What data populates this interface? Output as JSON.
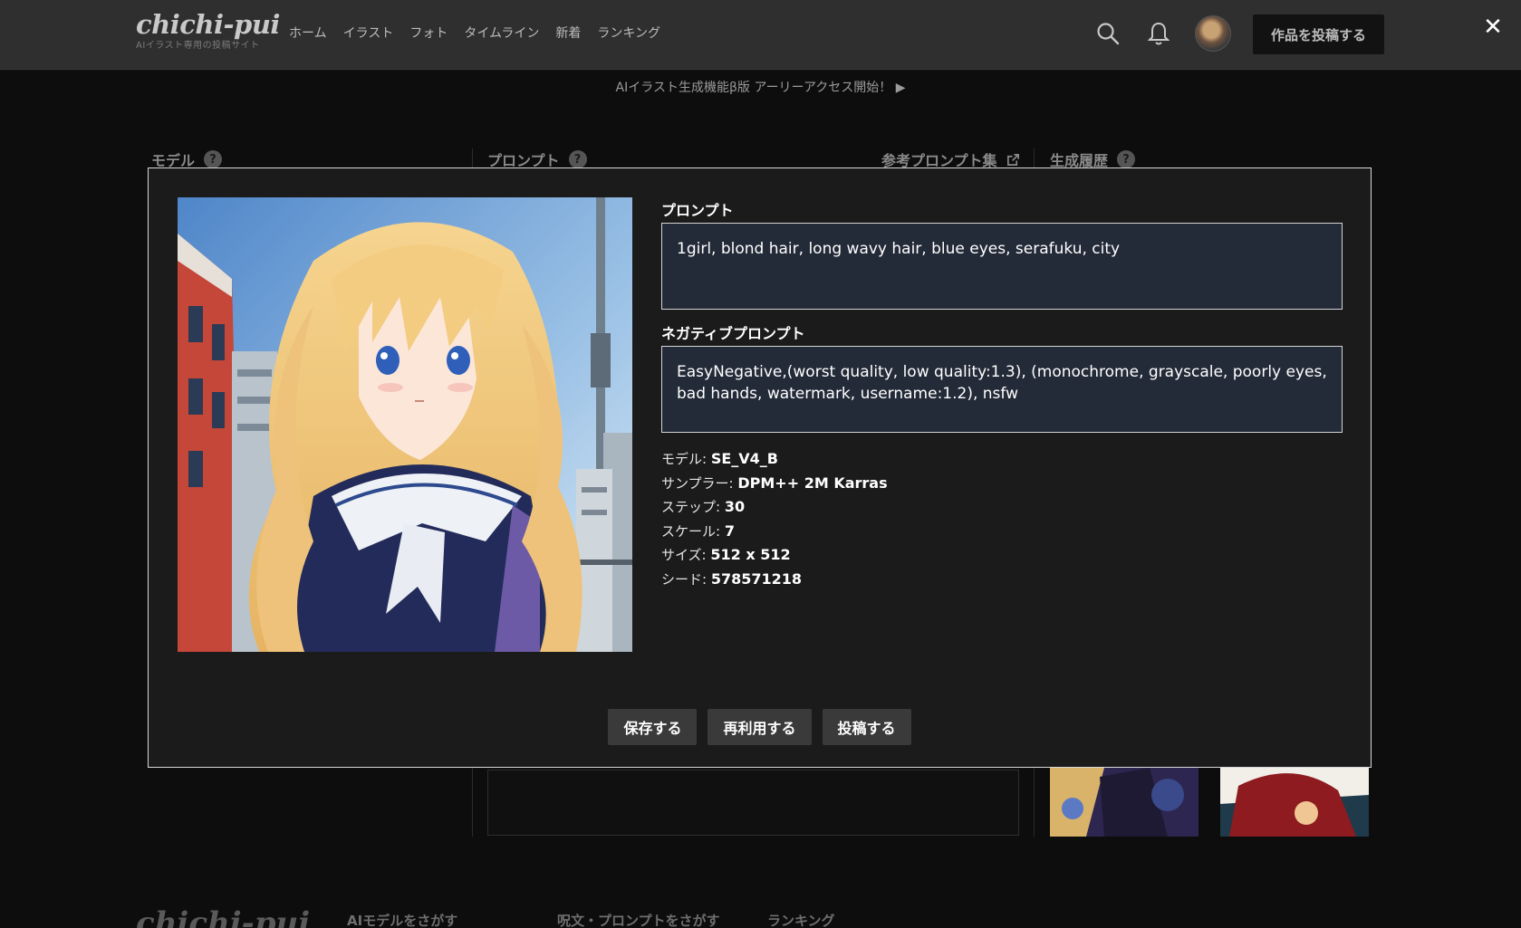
{
  "header": {
    "logo_text": "chichi-pui",
    "logo_sub": "AIイラスト専用の投稿サイト",
    "nav": [
      "ホーム",
      "イラスト",
      "フォト",
      "タイムライン",
      "新着",
      "ランキング"
    ],
    "post_button": "作品を投稿する",
    "close_glyph": "✕"
  },
  "background": {
    "announcement": "AIイラスト生成機能β版 アーリーアクセス開始！ ▶",
    "col_model": "モデル",
    "col_prompt": "プロンプト",
    "reference_link": "参考プロンプト集",
    "col_history": "生成履歴",
    "help_glyph": "?",
    "footer_logo": "chichi-pui",
    "footer_links": [
      "AIモデルをさがす",
      "呪文・プロンプトをさがす",
      "ランキング"
    ]
  },
  "modal": {
    "prompt_label": "プロンプト",
    "prompt_value": "1girl, blond hair, long wavy hair, blue eyes, serafuku, city",
    "negative_label": "ネガティブプロンプト",
    "negative_value": "EasyNegative,(worst quality, low quality:1.3), (monochrome, grayscale, poorly eyes, bad hands, watermark, username:1.2), nsfw",
    "params": [
      {
        "label": "モデル: ",
        "value": "SE_V4_B"
      },
      {
        "label": "サンプラー: ",
        "value": "DPM++ 2M Karras"
      },
      {
        "label": "ステップ: ",
        "value": "30"
      },
      {
        "label": "スケール: ",
        "value": "7"
      },
      {
        "label": "サイズ: ",
        "value": "512 x 512"
      },
      {
        "label": "シード: ",
        "value": "578571218"
      }
    ],
    "buttons": {
      "save": "保存する",
      "reuse": "再利用する",
      "post": "投稿する"
    }
  },
  "colors": {
    "header_bg": "#2f2f2f",
    "modal_bg": "#1b1b1b",
    "field_bg": "#232a38",
    "button_bg": "#3a3a3a"
  }
}
